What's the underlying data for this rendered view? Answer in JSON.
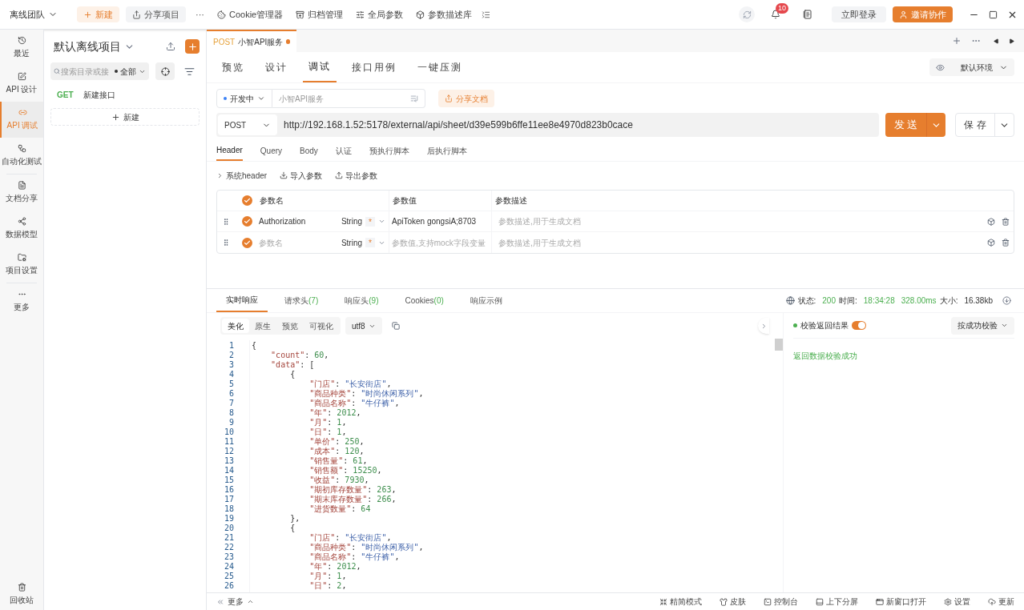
{
  "top_bar": {
    "team": "离线团队",
    "new_button": "新建",
    "share_button": "分享项目",
    "more": "···",
    "tools": [
      "Cookie管理器",
      "归档管理",
      "全局参数",
      "参数描述库"
    ],
    "notification_count": "10",
    "login_button": "立即登录",
    "invite_button": "邀请协作"
  },
  "rail": {
    "items": [
      {
        "label": "最近",
        "selected": false
      },
      {
        "label": "API 设计",
        "selected": false
      },
      {
        "label": "API 调试",
        "selected": true
      },
      {
        "label": "自动化测试",
        "selected": false
      },
      {
        "label": "文档分享",
        "selected": false
      },
      {
        "label": "数据模型",
        "selected": false
      },
      {
        "label": "项目设置",
        "selected": false
      },
      {
        "label": "更多",
        "selected": false
      }
    ],
    "trash": "回收站"
  },
  "project": {
    "title": "默认离线项目",
    "search_placeholder": "搜索目录或接",
    "filter": "全部",
    "tree": [
      {
        "method": "GET",
        "name": "新建接口"
      }
    ],
    "new_button": "新建"
  },
  "open_tabs": [
    {
      "method": "POST",
      "name": "小智API服务",
      "unsaved": true,
      "selected": true
    }
  ],
  "view_tabs": [
    {
      "label": "预览",
      "selected": false
    },
    {
      "label": "设计",
      "selected": false
    },
    {
      "label": "调试",
      "selected": true
    },
    {
      "label": "接口用例",
      "selected": false
    },
    {
      "label": "一键压测",
      "selected": false
    }
  ],
  "environment": "默认环境",
  "api_status": "开发中",
  "api_name_placeholder": "小智API服务",
  "share_doc_button": "分享文档",
  "request": {
    "method": "POST",
    "url": "http://192.168.1.52:5178/external/api/sheet/d39e599b6ffe11ee8e4970d823b0cace",
    "send_button": "发 送",
    "save_button": "保 存"
  },
  "request_tabs": [
    {
      "label": "Header",
      "selected": true
    },
    {
      "label": "Query",
      "selected": false
    },
    {
      "label": "Body",
      "selected": false
    },
    {
      "label": "认证",
      "selected": false
    },
    {
      "label": "预执行脚本",
      "selected": false
    },
    {
      "label": "后执行脚本",
      "selected": false
    }
  ],
  "header_actions": [
    "系统header",
    "导入参数",
    "导出参数"
  ],
  "params_table": {
    "all_checked": true,
    "columns": [
      "参数名",
      "参数值",
      "参数描述"
    ],
    "rows": [
      {
        "checked": true,
        "name": "Authorization",
        "type": "String",
        "required_mark": "*",
        "value": "ApiToken gongsiA;8703",
        "description_placeholder": "参数描述,用于生成文档"
      },
      {
        "checked": true,
        "name_placeholder": "参数名",
        "type": "String",
        "required_mark": "*",
        "value_placeholder": "参数值,支持mock字段变量",
        "description_placeholder": "参数描述,用于生成文档"
      }
    ]
  },
  "response_tabs": [
    {
      "label": "实时响应",
      "selected": true
    },
    {
      "label": "请求头",
      "count": "(7)",
      "selected": false
    },
    {
      "label": "响应头",
      "count": "(9)",
      "selected": false
    },
    {
      "label": "Cookies",
      "count": "(0)",
      "selected": false
    },
    {
      "label": "响应示例",
      "selected": false
    }
  ],
  "response_status": {
    "status_label": "状态:",
    "status": "200",
    "time_label": "时间:",
    "time": "18:34:28",
    "duration": "328.00ms",
    "size_label": "大小:",
    "size": "16.38kb"
  },
  "format_tabs": [
    {
      "label": "美化",
      "selected": true
    },
    {
      "label": "原生",
      "selected": false
    },
    {
      "label": "预览",
      "selected": false
    },
    {
      "label": "可视化",
      "selected": false
    }
  ],
  "encoding": "utf8",
  "code": [
    {
      "n": "1",
      "text": "{"
    },
    {
      "n": "2",
      "text": "    \"count\": 60,"
    },
    {
      "n": "3",
      "text": "    \"data\": ["
    },
    {
      "n": "4",
      "text": "        {"
    },
    {
      "n": "5",
      "text": "            \"门店\": \"长安街店\","
    },
    {
      "n": "6",
      "text": "            \"商品种类\": \"时尚休闲系列\","
    },
    {
      "n": "7",
      "text": "            \"商品名称\": \"牛仔裤\","
    },
    {
      "n": "8",
      "text": "            \"年\": 2012,"
    },
    {
      "n": "9",
      "text": "            \"月\": 1,"
    },
    {
      "n": "10",
      "text": "            \"日\": 1,"
    },
    {
      "n": "11",
      "text": "            \"单价\": 250,"
    },
    {
      "n": "12",
      "text": "            \"成本\": 120,"
    },
    {
      "n": "13",
      "text": "            \"销售量\": 61,"
    },
    {
      "n": "14",
      "text": "            \"销售额\": 15250,"
    },
    {
      "n": "15",
      "text": "            \"收益\": 7930,"
    },
    {
      "n": "16",
      "text": "            \"期初库存数量\": 263,"
    },
    {
      "n": "17",
      "text": "            \"期末库存数量\": 266,"
    },
    {
      "n": "18",
      "text": "            \"进货数量\": 64"
    },
    {
      "n": "19",
      "text": "        },"
    },
    {
      "n": "20",
      "text": "        {"
    },
    {
      "n": "21",
      "text": "            \"门店\": \"长安街店\","
    },
    {
      "n": "22",
      "text": "            \"商品种类\": \"时尚休闲系列\","
    },
    {
      "n": "23",
      "text": "            \"商品名称\": \"牛仔裤\","
    },
    {
      "n": "24",
      "text": "            \"年\": 2012,"
    },
    {
      "n": "25",
      "text": "            \"月\": 1,"
    },
    {
      "n": "26",
      "text": "            \"日\": 2,"
    }
  ],
  "validation": {
    "label": "校验返回结果",
    "on": true,
    "mode": "按成功校验",
    "result": "返回数据校验成功"
  },
  "footer": {
    "more": "更多",
    "items": [
      "精简模式",
      "皮肤",
      "控制台",
      "上下分屏",
      "新窗口打开",
      "设置",
      "更新"
    ]
  }
}
